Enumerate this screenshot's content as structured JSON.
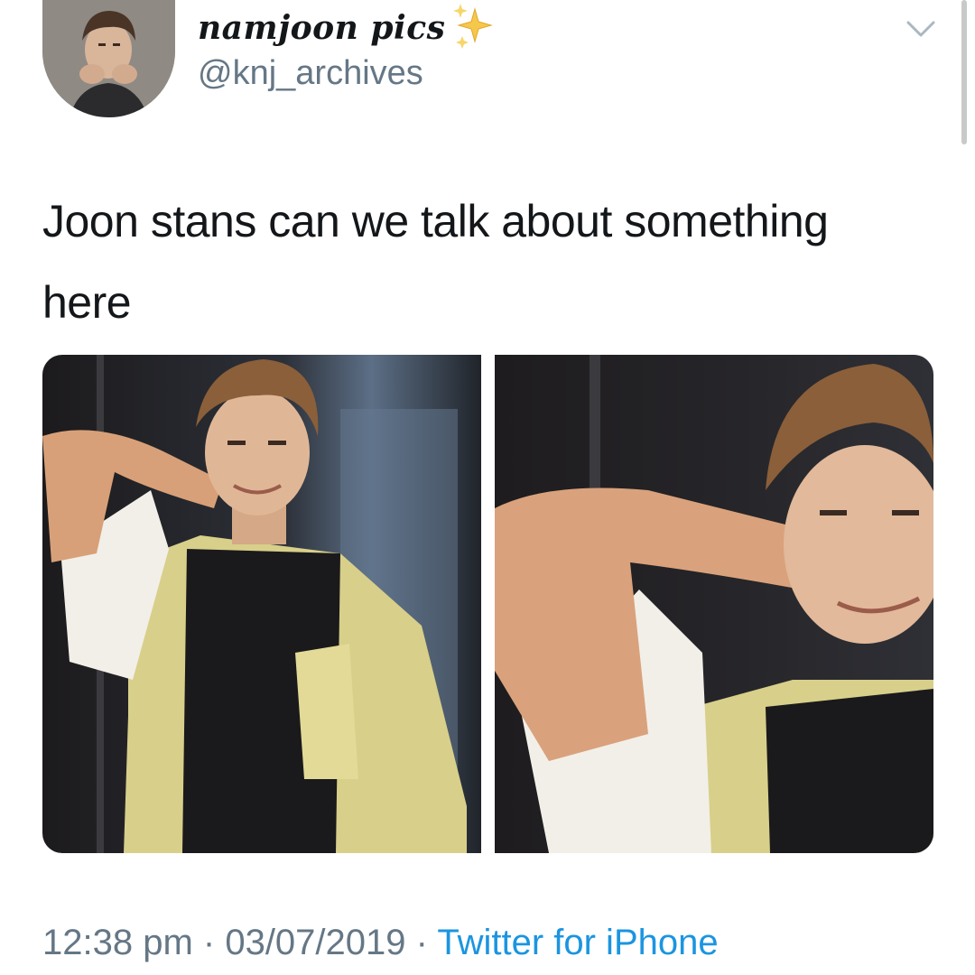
{
  "author": {
    "display_name": "namjoon pics",
    "handle": "@knj_archives",
    "badge_icon": "sparkles-icon"
  },
  "tweet": {
    "text": "Joon stans can we talk about something here"
  },
  "media": {
    "count": 2
  },
  "meta": {
    "time": "12:38 pm",
    "separator_1": " · ",
    "date": "03/07/2019",
    "separator_2": " · ",
    "source": "Twitter for iPhone"
  },
  "colors": {
    "text_primary": "#14171a",
    "text_secondary": "#657786",
    "link": "#1b95e0",
    "shirt_yellow": "#d8cf8a",
    "shirt_black": "#1a1a1c"
  }
}
